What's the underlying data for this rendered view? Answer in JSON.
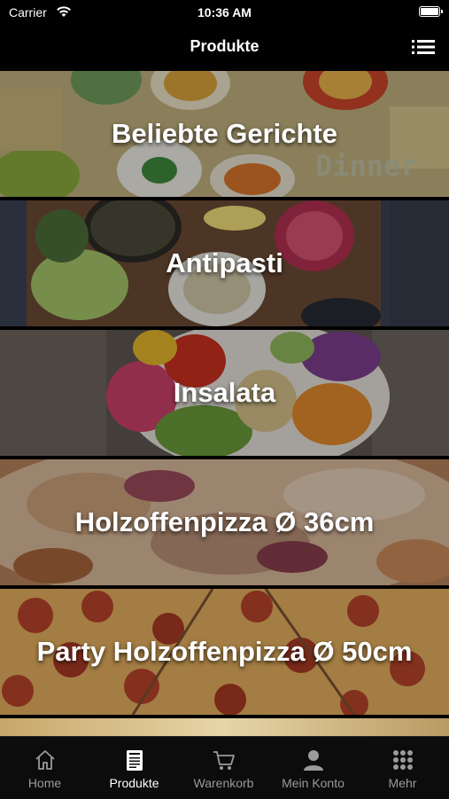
{
  "status_bar": {
    "carrier": "Carrier",
    "time": "10:36 AM"
  },
  "nav": {
    "title": "Produkte",
    "menu_icon": "list-icon"
  },
  "categories": [
    {
      "label": "Beliebte Gerichte",
      "image_text": "Dinner"
    },
    {
      "label": "Antipasti"
    },
    {
      "label": "Insalata"
    },
    {
      "label": "Holzoffenpizza Ø 36cm"
    },
    {
      "label": "Party Holzoffenpizza Ø 50cm"
    }
  ],
  "tabs": [
    {
      "label": "Home",
      "icon": "home-icon",
      "active": false
    },
    {
      "label": "Produkte",
      "icon": "menu-card-icon",
      "active": true
    },
    {
      "label": "Warenkorb",
      "icon": "cart-icon",
      "active": false
    },
    {
      "label": "Mein Konto",
      "icon": "user-icon",
      "active": false
    },
    {
      "label": "Mehr",
      "icon": "grid-icon",
      "active": false
    }
  ],
  "colors": {
    "background": "#000000",
    "tab_active": "#ffffff",
    "tab_inactive": "#9a9a9a"
  }
}
